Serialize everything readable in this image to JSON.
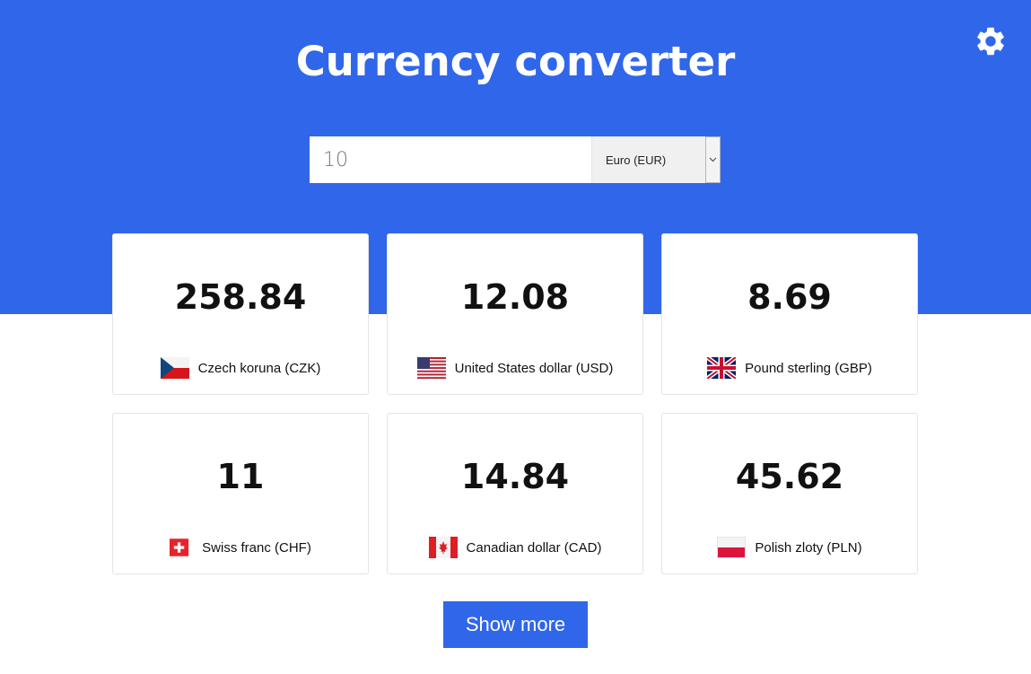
{
  "header": {
    "title": "Currency converter",
    "settings_icon": "gear-icon",
    "background_color": "#3066ea"
  },
  "converter": {
    "amount_value": "10",
    "currency_selected": "Euro (EUR)",
    "dropdown_icon": "chevron-down-icon"
  },
  "cards": [
    {
      "value": "258.84",
      "label": "Czech koruna (CZK)",
      "flag": "czech-flag-icon"
    },
    {
      "value": "12.08",
      "label": "United States dollar (USD)",
      "flag": "us-flag-icon"
    },
    {
      "value": "8.69",
      "label": "Pound sterling (GBP)",
      "flag": "uk-flag-icon"
    },
    {
      "value": "11",
      "label": "Swiss franc (CHF)",
      "flag": "swiss-flag-icon"
    },
    {
      "value": "14.84",
      "label": "Canadian dollar (CAD)",
      "flag": "canada-flag-icon"
    },
    {
      "value": "45.62",
      "label": "Polish zloty (PLN)",
      "flag": "poland-flag-icon"
    }
  ],
  "actions": {
    "show_more_label": "Show more"
  }
}
